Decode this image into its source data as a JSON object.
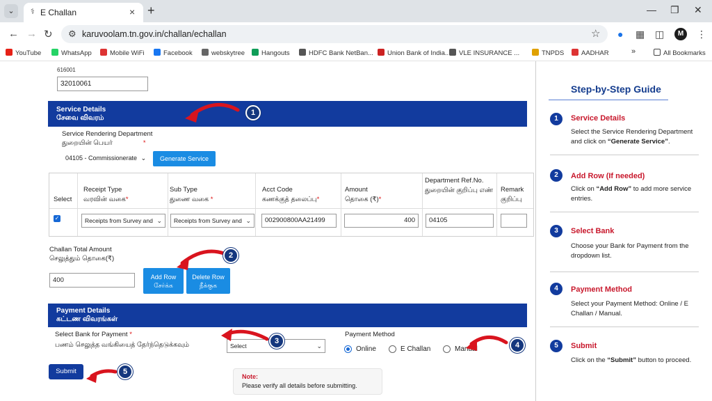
{
  "browser": {
    "tab_title": "E Challan",
    "url": "karuvoolam.tn.gov.in/challan/echallan",
    "avatar_letter": "M",
    "bookmarks": [
      {
        "label": "YouTube",
        "color": "#e62117"
      },
      {
        "label": "WhatsApp",
        "color": "#25d366"
      },
      {
        "label": "Mobile WiFi",
        "color": "#d33"
      },
      {
        "label": "Facebook",
        "color": "#1877f2"
      },
      {
        "label": "webskytree",
        "color": "#666"
      },
      {
        "label": "Hangouts",
        "color": "#0f9d58"
      },
      {
        "label": "HDFC Bank NetBan...",
        "color": "#555"
      },
      {
        "label": "Union Bank of India...",
        "color": "#c22"
      },
      {
        "label": "VLE INSURANCE ...",
        "color": "#555"
      },
      {
        "label": "TNPDS",
        "color": "#e0a100"
      },
      {
        "label": "AADHAR",
        "color": "#d33"
      }
    ],
    "all_bookmarks": "All Bookmarks"
  },
  "form": {
    "top_code": "616001",
    "top_input_value": "32010061",
    "service_details": {
      "title_en": "Service Details",
      "title_ta": "சேவை விவரம்",
      "dept_label_en": "Service Rendering Department",
      "dept_label_ta": "துறையின் பெயர்",
      "dept_value": "04105 - Commissionerate",
      "generate_button": "Generate Service"
    },
    "table": {
      "headers": [
        {
          "en": "Select",
          "ta": ""
        },
        {
          "en": "Receipt Type",
          "ta": "வரவின் வகை"
        },
        {
          "en": "Sub Type",
          "ta": "துணை வகை"
        },
        {
          "en": "Acct Code",
          "ta": "கணக்குத் தலைப்பு"
        },
        {
          "en": "Amount",
          "ta": "தொகை (₹)"
        },
        {
          "en": "Department Ref.No.",
          "ta": "துறையின் குறிப்பு எண்"
        },
        {
          "en": "Remark",
          "ta": "குறிப்பு"
        }
      ],
      "row": {
        "receipt_type": "Receipts from Survey and",
        "sub_type": "Receipts from Survey and",
        "acct_code": "002900800AA21499",
        "amount": "400",
        "dept_ref": "04105",
        "remark": ""
      }
    },
    "challan_total": {
      "label_en": "Challan Total Amount",
      "label_ta": "செலுத்தும் தொகை(₹)",
      "value": "400",
      "add_row_en": "Add Row",
      "add_row_ta": "சேர்க்க",
      "delete_row_en": "Delete Row",
      "delete_row_ta": "நீக்குக"
    },
    "payment_details": {
      "title_en": "Payment Details",
      "title_ta": "கட்டண விவரங்கள்",
      "bank_label_en": "Select Bank for Payment",
      "bank_label_ta": "பணம் செலுத்த வங்கியைத் தேர்ந்தெடுக்கவும்",
      "bank_value": "Select",
      "method_label": "Payment Method",
      "methods": [
        "Online",
        "E Challan",
        "Manual"
      ],
      "selected_method": "Online"
    },
    "submit": "Submit",
    "note_title": "Note:",
    "note_text": "Please verify all details before submitting.",
    "badges": [
      "1",
      "2",
      "3",
      "4",
      "5"
    ]
  },
  "guide": {
    "title": "Step-by-Step Guide",
    "steps": [
      {
        "num": "1",
        "title": "Service Details",
        "desc_pre": "Select the Service Rendering Department and click on ",
        "desc_bold": "“Generate Service”",
        "desc_post": "."
      },
      {
        "num": "2",
        "title": "Add Row (If needed)",
        "desc_pre": "Click on ",
        "desc_bold": "“Add Row”",
        "desc_post": " to add more service entries."
      },
      {
        "num": "3",
        "title": "Select Bank",
        "desc_pre": "Choose your Bank for Payment from the dropdown list.",
        "desc_bold": "",
        "desc_post": ""
      },
      {
        "num": "4",
        "title": "Payment Method",
        "desc_pre": "Select your Payment Method: Online / E Challan / Manual.",
        "desc_bold": "",
        "desc_post": ""
      },
      {
        "num": "5",
        "title": "Submit",
        "desc_pre": "Click on the ",
        "desc_bold": "“Submit”",
        "desc_post": " button to proceed."
      }
    ]
  },
  "colors": {
    "section_head": "#123b9e",
    "button_blue": "#1a8ce3",
    "arrow_red": "#d9141e",
    "guide_red": "#c8182c"
  }
}
